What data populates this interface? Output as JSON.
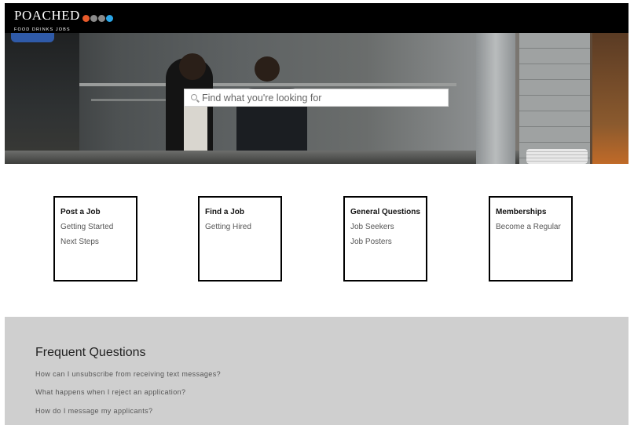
{
  "brand": {
    "name": "POACHED",
    "tagline": "FOOD DRINKS JOBS",
    "dot_colors": [
      "#e85a2a",
      "#8a8a8a",
      "#8a8a8a",
      "#2aa6e8"
    ]
  },
  "search": {
    "placeholder": "Find what you're looking for"
  },
  "categories": [
    {
      "title": "Post a Job",
      "links": [
        "Getting Started",
        "Next Steps"
      ]
    },
    {
      "title": "Find a Job",
      "links": [
        "Getting Hired"
      ]
    },
    {
      "title": "General Questions",
      "links": [
        "Job Seekers",
        "Job Posters"
      ]
    },
    {
      "title": "Memberships",
      "links": [
        "Become a Regular"
      ]
    }
  ],
  "faq": {
    "title": "Frequent Questions",
    "questions": [
      "How can I unsubscribe from receiving text messages?",
      "What happens when I reject an application?",
      "How do I message my applicants?"
    ]
  }
}
